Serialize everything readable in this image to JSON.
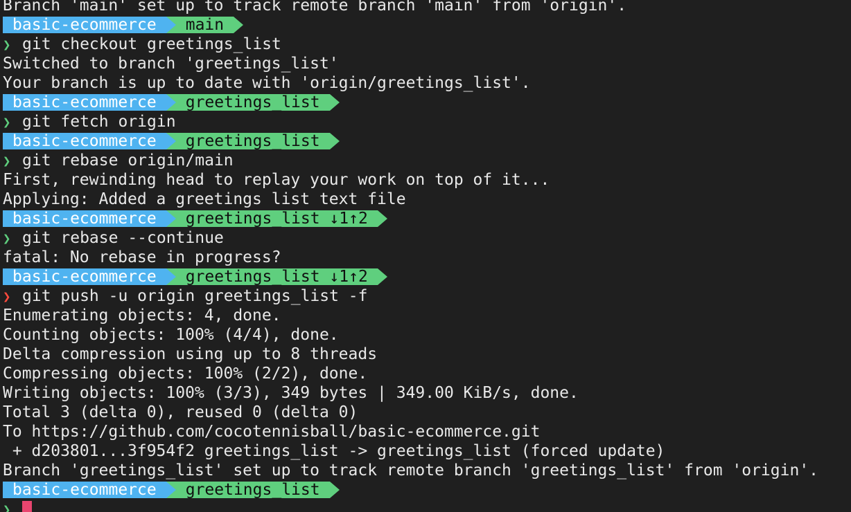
{
  "terminal": {
    "colors": {
      "background": "#1f1f1f",
      "dir_segment": "#4fb3f0",
      "branch_segment": "#5fcf7e",
      "chevron_ok": "#5fcf7e",
      "chevron_error": "#ff4a3d",
      "cursor": "#e8456f"
    },
    "lines": [
      {
        "type": "output",
        "text": "Branch 'main' set up to track remote branch 'main' from 'origin'."
      },
      {
        "type": "prompt",
        "dir": "basic-ecommerce",
        "branch": "main"
      },
      {
        "type": "command",
        "chevron": "❯",
        "status": "ok",
        "text": "git checkout greetings_list"
      },
      {
        "type": "output",
        "text": "Switched to branch 'greetings_list'"
      },
      {
        "type": "output",
        "text": "Your branch is up to date with 'origin/greetings_list'."
      },
      {
        "type": "prompt",
        "dir": "basic-ecommerce",
        "branch": "greetings_list"
      },
      {
        "type": "command",
        "chevron": "❯",
        "status": "ok",
        "text": "git fetch origin"
      },
      {
        "type": "prompt",
        "dir": "basic-ecommerce",
        "branch": "greetings_list"
      },
      {
        "type": "command",
        "chevron": "❯",
        "status": "ok",
        "text": "git rebase origin/main"
      },
      {
        "type": "output",
        "text": "First, rewinding head to replay your work on top of it..."
      },
      {
        "type": "output",
        "text": "Applying: Added a greetings list text file"
      },
      {
        "type": "prompt",
        "dir": "basic-ecommerce",
        "branch": "greetings_list ↓1↑2"
      },
      {
        "type": "command",
        "chevron": "❯",
        "status": "ok",
        "text": "git rebase --continue"
      },
      {
        "type": "output",
        "text": "fatal: No rebase in progress?"
      },
      {
        "type": "prompt",
        "dir": "basic-ecommerce",
        "branch": "greetings_list ↓1↑2"
      },
      {
        "type": "command",
        "chevron": "❯",
        "status": "error",
        "text": "git push -u origin greetings_list -f"
      },
      {
        "type": "output",
        "text": "Enumerating objects: 4, done."
      },
      {
        "type": "output",
        "text": "Counting objects: 100% (4/4), done."
      },
      {
        "type": "output",
        "text": "Delta compression using up to 8 threads"
      },
      {
        "type": "output",
        "text": "Compressing objects: 100% (2/2), done."
      },
      {
        "type": "output",
        "text": "Writing objects: 100% (3/3), 349 bytes | 349.00 KiB/s, done."
      },
      {
        "type": "output",
        "text": "Total 3 (delta 0), reused 0 (delta 0)"
      },
      {
        "type": "output",
        "text": "To https://github.com/cocotennisball/basic-ecommerce.git"
      },
      {
        "type": "output",
        "text": " + d203801...3f954f2 greetings_list -> greetings_list (forced update)"
      },
      {
        "type": "output",
        "text": "Branch 'greetings_list' set up to track remote branch 'greetings_list' from 'origin'."
      },
      {
        "type": "prompt",
        "dir": "basic-ecommerce",
        "branch": "greetings_list"
      },
      {
        "type": "input",
        "chevron": "❯",
        "status": "ok",
        "text": ""
      }
    ]
  }
}
